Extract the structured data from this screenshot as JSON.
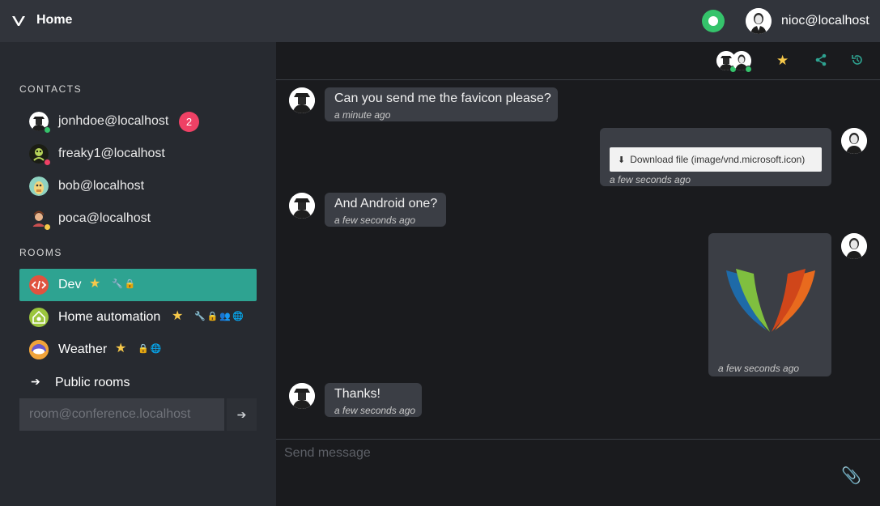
{
  "topbar": {
    "title": "Home",
    "user_name": "nioc@localhost",
    "presence_status": "online"
  },
  "sidebar": {
    "contacts_title": "CONTACTS",
    "contacts": [
      {
        "name": "jonhdoe@localhost",
        "badge": "2",
        "status_color": "#35c36b"
      },
      {
        "name": "freaky1@localhost",
        "status_color": "#ef4165"
      },
      {
        "name": "bob@localhost"
      },
      {
        "name": "poca@localhost",
        "status_color": "#f6c84a"
      }
    ],
    "rooms_title": "ROOMS",
    "rooms": [
      {
        "name": "Dev",
        "icons": "🔧🔒",
        "active": true
      },
      {
        "name": "Home automation",
        "icons": "🔧🔒👥🌐"
      },
      {
        "name": "Weather",
        "icons": "🔒🌐"
      }
    ],
    "public_rooms_label": "Public rooms",
    "join_placeholder": "room@conference.localhost"
  },
  "chat": {
    "messages": [
      {
        "text": "Can you send me the favicon please?",
        "time": "a minute ago",
        "direction": "incoming"
      },
      {
        "download_label": "Download file (image/vnd.microsoft.icon)",
        "time": "a few seconds ago",
        "direction": "outgoing"
      },
      {
        "text": "And Android one?",
        "time": "a few seconds ago",
        "direction": "incoming"
      },
      {
        "time": "a few seconds ago",
        "direction": "outgoing",
        "image": "xmpp-logo"
      },
      {
        "text": "Thanks!",
        "time": "a few seconds ago",
        "direction": "incoming"
      }
    ],
    "composer_placeholder": "Send message"
  },
  "colors": {
    "accent": "#2ea391",
    "badge": "#ef4165",
    "online": "#35c36b",
    "star": "#f6c84a"
  }
}
